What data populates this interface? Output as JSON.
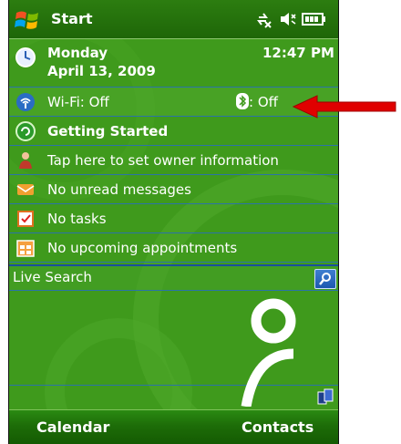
{
  "titlebar": {
    "title": "Start",
    "logo_icon": "windows-flag-icon",
    "status_icons": [
      "connectivity-icon",
      "speaker-mute-icon",
      "battery-icon"
    ]
  },
  "today": {
    "day": "Monday",
    "date": "April 13, 2009",
    "time": "12:47 PM",
    "icon": "clock-icon"
  },
  "wireless": {
    "wifi_label": "Wi-Fi: Off",
    "bluetooth_label": ": Off",
    "wifi_icon": "wifi-icon",
    "bluetooth_icon": "bluetooth-icon"
  },
  "items": {
    "getting_started": "Getting Started",
    "owner": "Tap here to set owner information",
    "messages": "No unread messages",
    "tasks": "No tasks",
    "appointments": "No upcoming appointments"
  },
  "search": {
    "label": "Live Search",
    "icon": "search-icon"
  },
  "softkeys": {
    "left": "Calendar",
    "right": "Contacts"
  },
  "colors": {
    "background": "#3f9a1c",
    "titlebar": "#2c7d10",
    "separator": "#2b73a8",
    "annotation_arrow": "#e00000"
  }
}
